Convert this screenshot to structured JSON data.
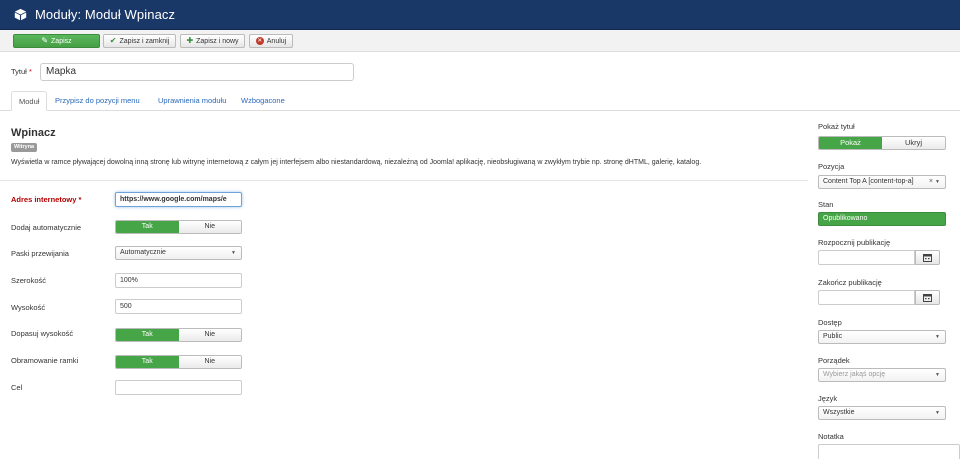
{
  "header": {
    "title": "Moduły: Moduł Wpinacz",
    "background": "#1a3867"
  },
  "toolbar": {
    "save": "Zapisz",
    "save_close": "Zapisz i zamknij",
    "save_new": "Zapisz i nowy",
    "cancel": "Anuluj"
  },
  "title_field": {
    "label": "Tytuł",
    "required_mark": "*",
    "value": "Mapka"
  },
  "tabs": [
    {
      "label": "Moduł",
      "active": true
    },
    {
      "label": "Przypisz do pozycji menu"
    },
    {
      "label": "Uprawnienia modułu"
    },
    {
      "label": "Wzbogacone"
    }
  ],
  "module": {
    "name": "Wpinacz",
    "badge": "Witryna",
    "description": "Wyświetla w ramce pływającej dowolną inną stronę lub witrynę internetową z całym jej interfejsem albo niestandardową, niezależną od Joomla! aplikację, nieobsługiwaną w zwykłym trybie np. stronę dHTML, galerię, katalog."
  },
  "form": {
    "url": {
      "label": "Adres internetowy",
      "required_mark": "*",
      "value": "https://www.google.com/maps/e"
    },
    "auto_add": {
      "label": "Dodaj automatycznie",
      "yes": "Tak",
      "no": "Nie",
      "selected": "Tak"
    },
    "scrollbars": {
      "label": "Paski przewijania",
      "value": "Automatycznie"
    },
    "width": {
      "label": "Szerokość",
      "value": "100%"
    },
    "height": {
      "label": "Wysokość",
      "value": "500"
    },
    "auto_height": {
      "label": "Dopasuj wysokość",
      "yes": "Tak",
      "no": "Nie",
      "selected": "Tak"
    },
    "frame_border": {
      "label": "Obramowanie ramki",
      "yes": "Tak",
      "no": "Nie",
      "selected": "Tak"
    },
    "target": {
      "label": "Cel",
      "value": ""
    }
  },
  "sidebar": {
    "show_title": {
      "label": "Pokaż tytuł",
      "show": "Pokaż",
      "hide": "Ukryj",
      "selected": "Pokaż"
    },
    "position": {
      "label": "Pozycja",
      "value": "Content Top A [content-top-a]",
      "clear": "×"
    },
    "state": {
      "label": "Stan",
      "value": "Opublikowano"
    },
    "publish_up": {
      "label": "Rozpocznij publikację",
      "value": ""
    },
    "publish_down": {
      "label": "Zakończ publikację",
      "value": ""
    },
    "access": {
      "label": "Dostęp",
      "value": "Public"
    },
    "ordering": {
      "label": "Porządek",
      "placeholder": "Wybierz jakąś opcję"
    },
    "language": {
      "label": "Język",
      "value": "Wszystkie"
    },
    "note": {
      "label": "Notatka",
      "value": ""
    }
  },
  "colors": {
    "accent_green": "#46a546",
    "link_blue": "#2a69b8",
    "required_red": "#b30000"
  }
}
